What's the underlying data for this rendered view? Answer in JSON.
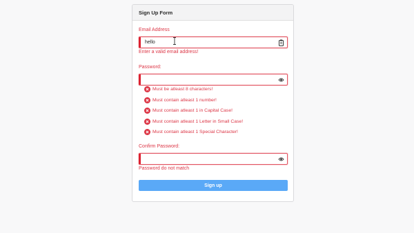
{
  "form": {
    "title": "Sign Up Form",
    "email": {
      "label": "Email Address",
      "value": "hello",
      "error": "Enter a valid email address!",
      "icon": "clipboard-icon"
    },
    "password": {
      "label": "Password:",
      "value": "",
      "icon": "eye-icon",
      "rules": [
        "Must be atleast 8 characters!",
        "Must contain atleast 1 number!",
        "Must contain atleast 1 in Capital Case!",
        "Must contain atleast 1 Letter in Small Case!",
        "Must contain atleast 1 Special Character!"
      ]
    },
    "confirm": {
      "label": "Confirm Password:",
      "value": "",
      "error": "Password do not match",
      "icon": "eye-icon"
    },
    "submit_label": "Sign up"
  },
  "colors": {
    "error": "#dc3545",
    "button": "#5aa9f7",
    "page_bg": "#f8f8f9"
  }
}
